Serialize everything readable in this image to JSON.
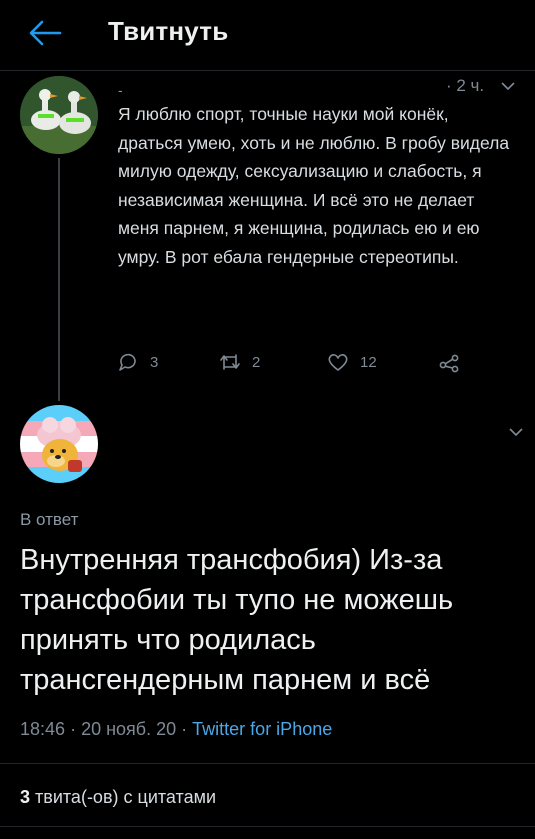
{
  "header": {
    "title": "Твитнуть",
    "back_icon": "arrow-left-icon"
  },
  "parent_tweet": {
    "name": "-",
    "time": "· 2 ч.",
    "text": "Я люблю спорт, точные науки мой конёк, драться умею, хоть и не люблю. В гробу видела милую одежду, сексуализацию и слабость, я независимая женщина. И всё это не делает меня парнем, я женщина, родилась ею и ею умру. В рот ебала гендерные стереотипы.",
    "actions": {
      "replies": "3",
      "retweets": "2",
      "likes": "12"
    }
  },
  "reply_tweet": {
    "in_reply_label": "В ответ",
    "text": "Внутренняя трансфобия) Из-за трансфобии ты тупо не можешь принять что родилась трансгендерным парнем и всё",
    "time": "18:46",
    "sep1": "·",
    "date": "20 нояб. 20",
    "sep2": "·",
    "source": "Twitter for iPhone",
    "quotes_count": "3",
    "quotes_label": "твита(-ов) с цитатами"
  },
  "colors": {
    "background": "#000000",
    "text": "#e7e9ea",
    "muted": "#7f8a95",
    "link": "#4aa8e8"
  }
}
